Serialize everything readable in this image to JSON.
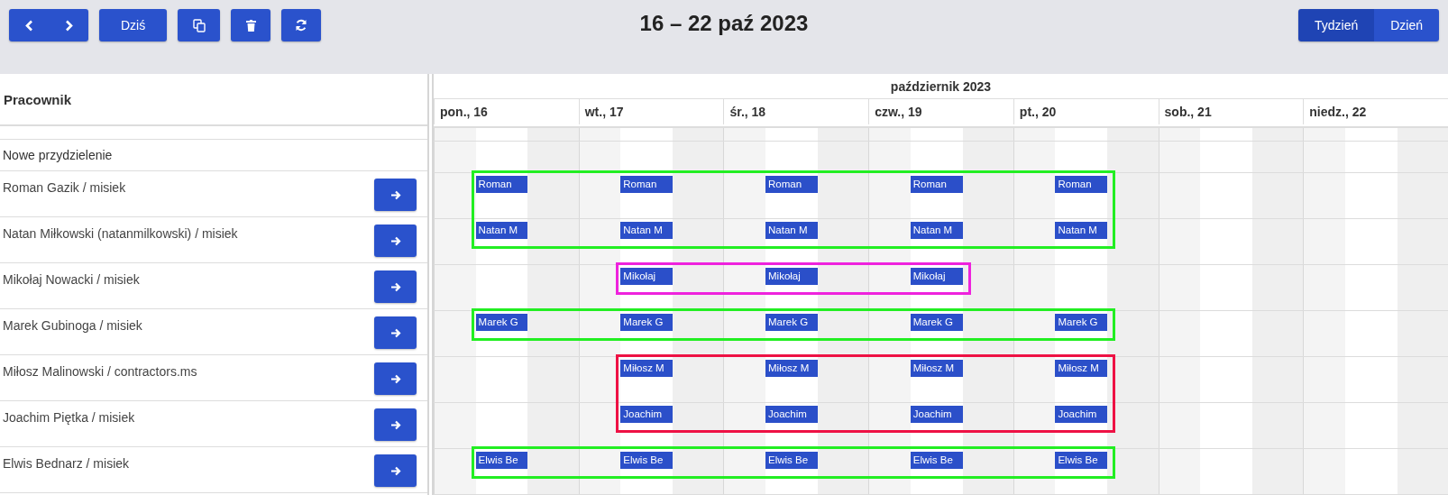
{
  "toolbar": {
    "today": "Dziś",
    "title": "16 – 22 paź 2023",
    "views": [
      {
        "label": "Tydzień",
        "selected": true
      },
      {
        "label": "Dzień",
        "selected": false
      }
    ]
  },
  "header": {
    "column": "Pracownik",
    "month": "październik 2023",
    "days": [
      "pon., 16",
      "wt., 17",
      "śr., 18",
      "czw., 19",
      "pt., 20",
      "sob., 21",
      "niedz., 22"
    ]
  },
  "new_assignment": "Nowe przydzielenie",
  "groups": [
    {
      "color": "#22ee22",
      "employees": [
        {
          "name": "Roman Gazik / misiek",
          "shifts": [
            {
              "on": true,
              "label": "Roman"
            },
            {
              "on": true,
              "label": "Roman"
            },
            {
              "on": true,
              "label": "Roman"
            },
            {
              "on": true,
              "label": "Roman"
            },
            {
              "on": true,
              "label": "Roman"
            },
            {
              "on": false
            },
            {
              "on": false
            }
          ]
        },
        {
          "name": "Natan Miłkowski (natanmilkowski) / misiek",
          "shifts": [
            {
              "on": true,
              "label": "Natan M"
            },
            {
              "on": true,
              "label": "Natan M"
            },
            {
              "on": true,
              "label": "Natan M"
            },
            {
              "on": true,
              "label": "Natan M"
            },
            {
              "on": true,
              "label": "Natan M"
            },
            {
              "on": false
            },
            {
              "on": false
            }
          ]
        }
      ]
    },
    {
      "color": "#ee22dd",
      "employees": [
        {
          "name": "Mikołaj Nowacki / misiek",
          "shifts": [
            {
              "on": false
            },
            {
              "on": true,
              "label": "Mikołaj"
            },
            {
              "on": true,
              "label": "Mikołaj"
            },
            {
              "on": true,
              "label": "Mikołaj"
            },
            {
              "on": false
            },
            {
              "on": false
            },
            {
              "on": false
            }
          ]
        }
      ]
    },
    {
      "color": "#22ee22",
      "employees": [
        {
          "name": "Marek Gubinoga / misiek",
          "shifts": [
            {
              "on": true,
              "label": "Marek G"
            },
            {
              "on": true,
              "label": "Marek G"
            },
            {
              "on": true,
              "label": "Marek G"
            },
            {
              "on": true,
              "label": "Marek G"
            },
            {
              "on": true,
              "label": "Marek G"
            },
            {
              "on": false
            },
            {
              "on": false
            }
          ]
        }
      ]
    },
    {
      "color": "#ee1144",
      "employees": [
        {
          "name": "Miłosz Malinowski / contractors.ms",
          "shifts": [
            {
              "on": false
            },
            {
              "on": true,
              "label": "Miłosz M"
            },
            {
              "on": true,
              "label": "Miłosz M"
            },
            {
              "on": true,
              "label": "Miłosz M"
            },
            {
              "on": true,
              "label": "Miłosz M"
            },
            {
              "on": false
            },
            {
              "on": false
            }
          ]
        },
        {
          "name": "Joachim Piętka / misiek",
          "shifts": [
            {
              "on": false
            },
            {
              "on": true,
              "label": "Joachim"
            },
            {
              "on": true,
              "label": "Joachim"
            },
            {
              "on": true,
              "label": "Joachim"
            },
            {
              "on": true,
              "label": "Joachim"
            },
            {
              "on": false
            },
            {
              "on": false
            }
          ]
        }
      ]
    },
    {
      "color": "#22ee22",
      "employees": [
        {
          "name": "Elwis Bednarz / misiek",
          "shifts": [
            {
              "on": true,
              "label": "Elwis Be"
            },
            {
              "on": true,
              "label": "Elwis Be"
            },
            {
              "on": true,
              "label": "Elwis Be"
            },
            {
              "on": true,
              "label": "Elwis Be"
            },
            {
              "on": true,
              "label": "Elwis Be"
            },
            {
              "on": false
            },
            {
              "on": false
            }
          ]
        }
      ]
    }
  ]
}
